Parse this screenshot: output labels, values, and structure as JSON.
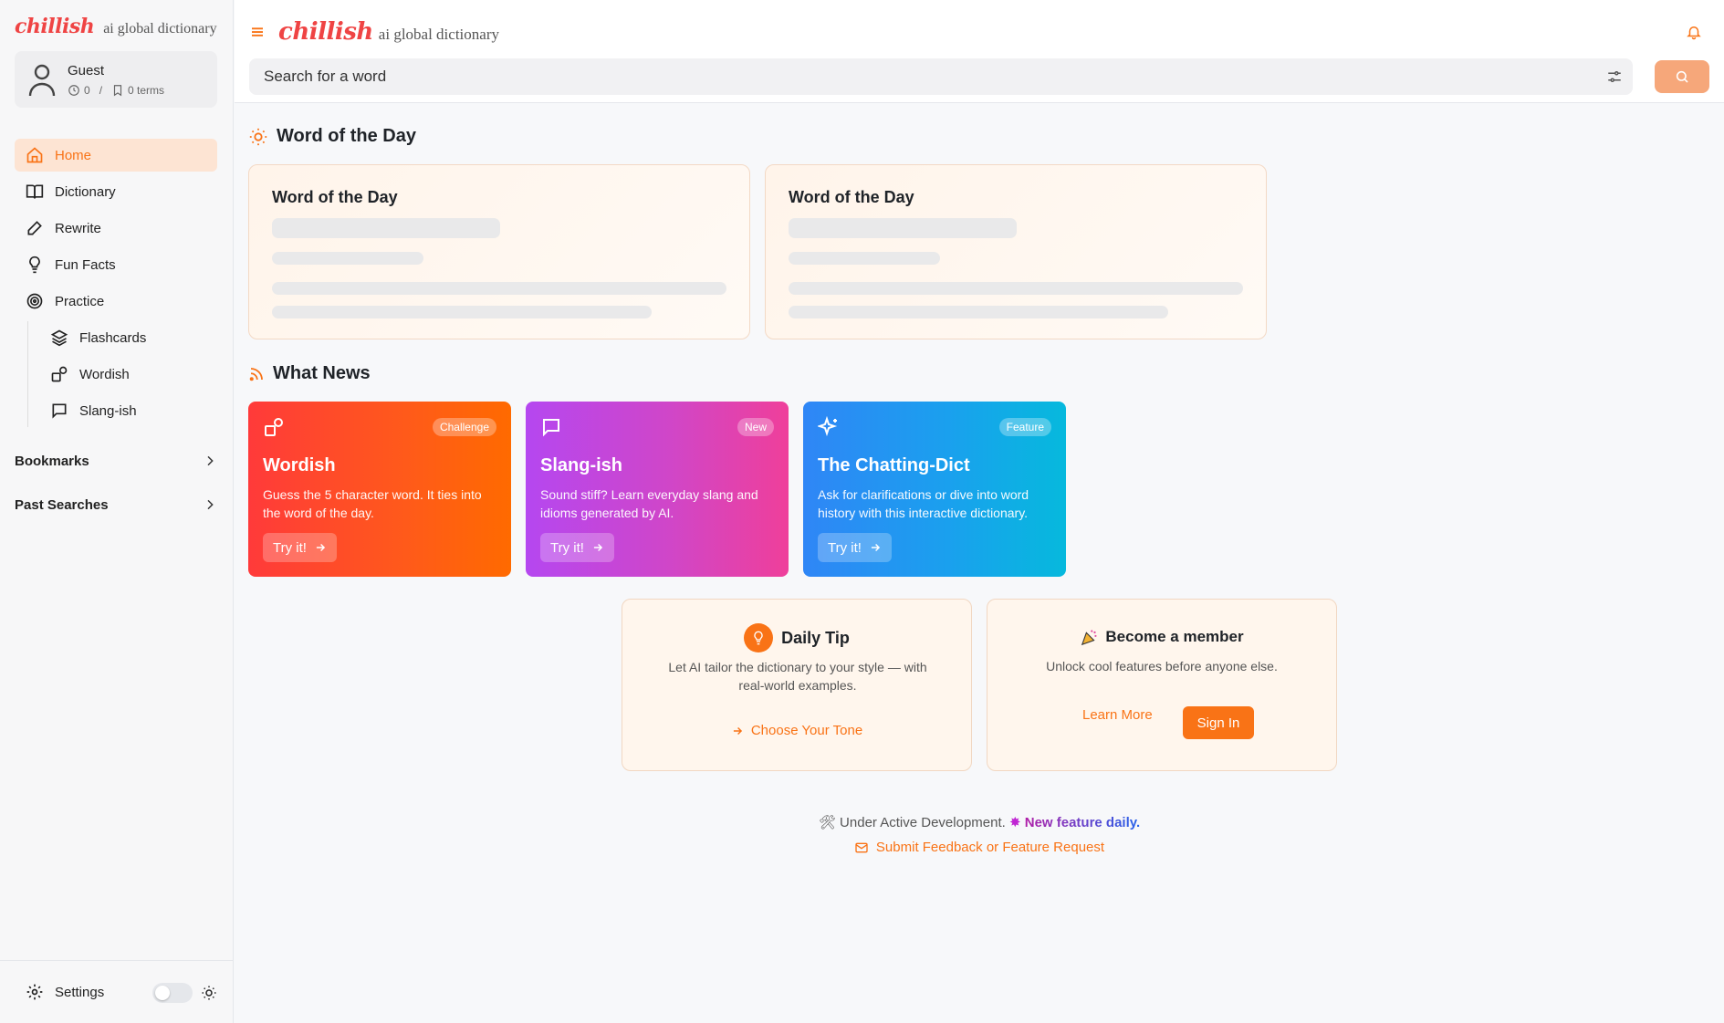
{
  "sidebar": {
    "logo": "chillish",
    "tagline": "ai global dictionary",
    "user": {
      "name": "Guest",
      "history_count": "0",
      "separator": "/",
      "terms": "0 terms"
    },
    "nav": [
      {
        "label": "Home",
        "icon": "home-icon",
        "active": true
      },
      {
        "label": "Dictionary",
        "icon": "book-icon"
      },
      {
        "label": "Rewrite",
        "icon": "pencil-icon"
      },
      {
        "label": "Fun Facts",
        "icon": "lightbulb-icon"
      },
      {
        "label": "Practice",
        "icon": "target-icon"
      }
    ],
    "practice_sub": [
      {
        "label": "Flashcards",
        "icon": "layers-icon"
      },
      {
        "label": "Wordish",
        "icon": "shapes-icon"
      },
      {
        "label": "Slang-ish",
        "icon": "message-icon"
      }
    ],
    "bookmarks": "Bookmarks",
    "past_searches": "Past Searches",
    "settings": "Settings"
  },
  "header": {
    "logo": "chillish",
    "tagline": "ai global dictionary",
    "search_placeholder": "Search for a word"
  },
  "word_of_day": {
    "section_title": "Word of the Day",
    "cards": [
      {
        "title": "Word of the Day"
      },
      {
        "title": "Word of the Day"
      }
    ]
  },
  "news": {
    "section_title": "What News",
    "cards": [
      {
        "badge": "Challenge",
        "title": "Wordish",
        "desc": "Guess the 5 character word. It ties into the word of the day.",
        "button": "Try it!"
      },
      {
        "badge": "New",
        "title": "Slang-ish",
        "desc": "Sound stiff? Learn everyday slang and idioms generated by AI.",
        "button": "Try it!"
      },
      {
        "badge": "Feature",
        "title": "The Chatting-Dict",
        "desc": "Ask for clarifications or dive into word history with this interactive dictionary.",
        "button": "Try it!"
      }
    ]
  },
  "tip": {
    "title": "Daily Tip",
    "text": "Let AI tailor the dictionary to your style — with real-world examples.",
    "link": "Choose Your Tone"
  },
  "member": {
    "title": "Become a member",
    "text": "Unlock cool features before anyone else.",
    "learn_more": "Learn More",
    "sign_in": "Sign In"
  },
  "footer": {
    "dev_text": "Under Active Development.",
    "highlight": "New feature daily.",
    "feedback": "Submit Feedback or Feature Request"
  },
  "colors": {
    "accent": "#f97316",
    "logo": "#ef4444"
  }
}
